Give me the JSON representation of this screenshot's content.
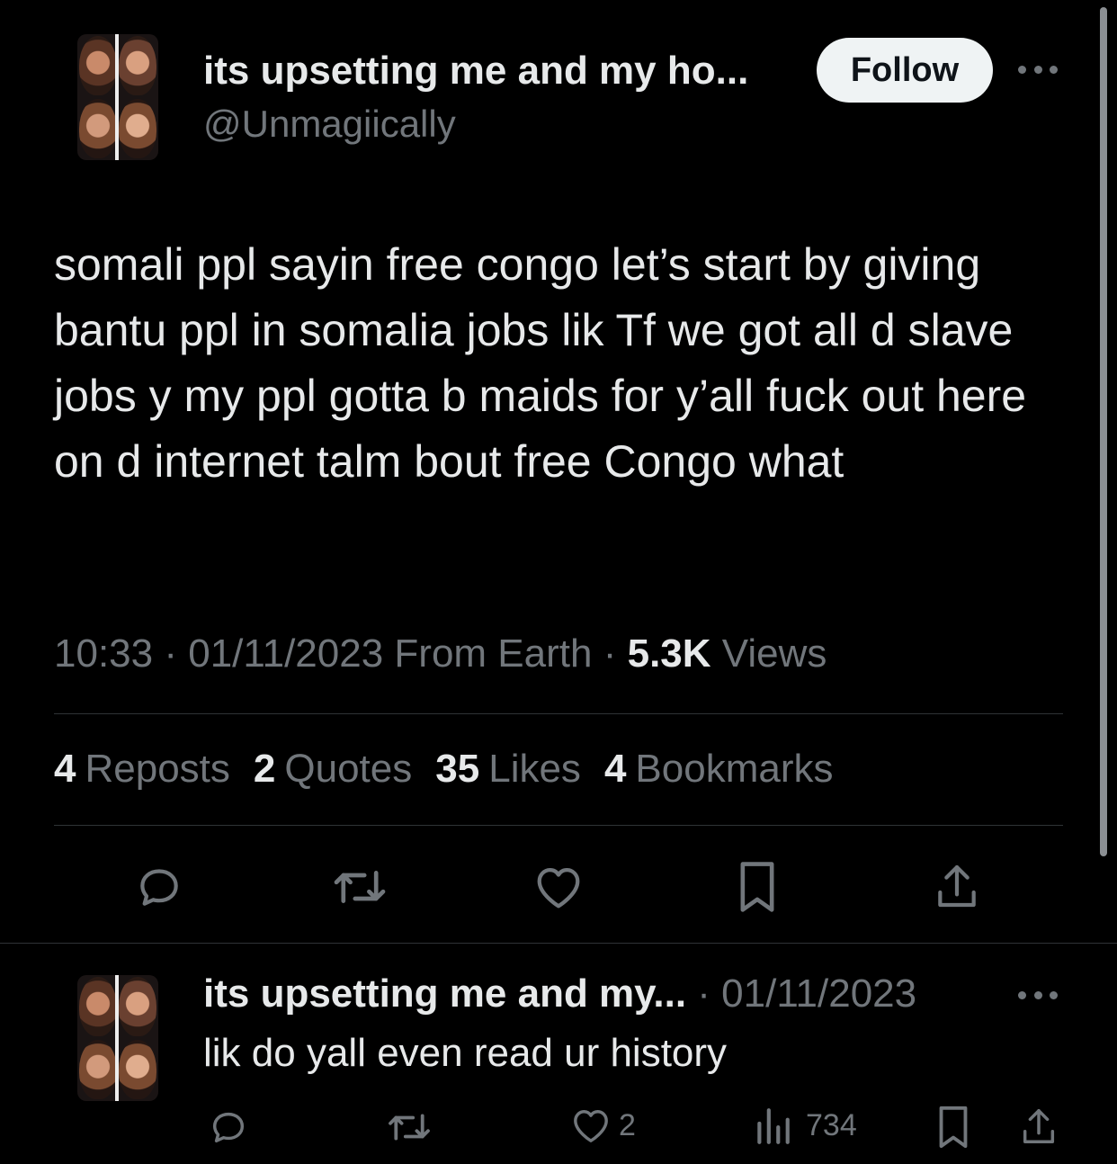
{
  "tweet": {
    "author_name": "its upsetting me and my ho...",
    "author_handle": "@Unmagiically",
    "follow_label": "Follow",
    "text": "somali ppl sayin free congo let’s start by giving bantu ppl in somalia jobs lik Tf we got all d slave jobs y my ppl gotta b maids for y’all fuck out here on d internet talm bout free Congo what",
    "time": "10:33",
    "date": "01/11/2023",
    "source": "From Earth",
    "views_count": "5.3K",
    "views_label": "Views",
    "stats": {
      "reposts_count": "4",
      "reposts_label": "Reposts",
      "quotes_count": "2",
      "quotes_label": "Quotes",
      "likes_count": "35",
      "likes_label": "Likes",
      "bookmarks_count": "4",
      "bookmarks_label": "Bookmarks"
    }
  },
  "reply": {
    "author_name": "its upsetting me and my...",
    "separator": "·",
    "date": "01/11/2023",
    "text": "lik do yall even read ur history",
    "likes_count": "2",
    "views_count": "734"
  },
  "icons": [
    "reply-icon",
    "repost-icon",
    "like-icon",
    "bookmark-icon",
    "share-icon",
    "more-icon",
    "views-icon"
  ],
  "colors": {
    "background": "#000000",
    "text": "#e7e9ea",
    "muted": "#71767b",
    "divider": "#2f3336",
    "follow_bg": "#eff3f4"
  }
}
